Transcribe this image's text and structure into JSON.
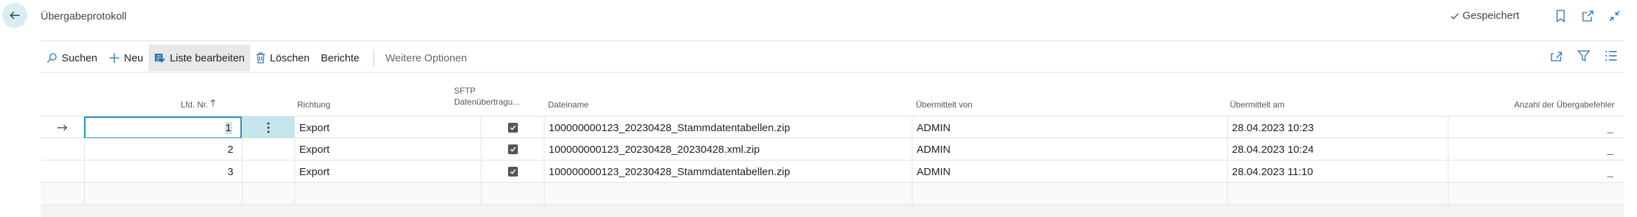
{
  "header": {
    "title": "Übergabeprotokoll",
    "saved_label": "Gespeichert"
  },
  "actions": {
    "search": "Suchen",
    "new": "Neu",
    "edit_list": "Liste bearbeiten",
    "delete": "Löschen",
    "reports": "Berichte",
    "more": "Weitere Optionen"
  },
  "columns": {
    "lfd_nr": "Lfd. Nr.",
    "richtung": "Richtung",
    "sftp_line1": "SFTP",
    "sftp_line2": "Datenübertragu...",
    "dateiname": "Dateiname",
    "uebermittelt_von": "Übermittelt von",
    "uebermittelt_am": "Übermittelt am",
    "anzahl_fehler": "Anzahl der Übergabefehler"
  },
  "rows": [
    {
      "lfd_nr": "1",
      "richtung": "Export",
      "sftp": true,
      "dateiname": "100000000123_20230428_Stammdatentabellen.zip",
      "von": "ADMIN",
      "am": "28.04.2023 10:23",
      "fehler": "_"
    },
    {
      "lfd_nr": "2",
      "richtung": "Export",
      "sftp": true,
      "dateiname": "100000000123_20230428_20230428.xml.zip",
      "von": "ADMIN",
      "am": "28.04.2023 10:24",
      "fehler": "_"
    },
    {
      "lfd_nr": "3",
      "richtung": "Export",
      "sftp": true,
      "dateiname": "100000000123_20230428_Stammdatentabellen.zip",
      "von": "ADMIN",
      "am": "28.04.2023 11:10",
      "fehler": "_"
    }
  ],
  "icons": {
    "back": "back-arrow-icon",
    "saved": "checkmark-icon",
    "bookmark": "bookmark-icon",
    "popout": "open-in-new-window-icon",
    "collapse": "collapse-icon",
    "share": "share-icon",
    "filter": "filter-icon",
    "list": "list-view-icon",
    "search": "search-icon",
    "add": "plus-icon",
    "edit_list": "edit-list-icon",
    "delete": "trash-icon",
    "row_arrow": "row-arrow-icon",
    "row_menu": "more-vertical-icon",
    "sort": "sort-ascending-icon"
  },
  "colors": {
    "accent": "#1d8fb8",
    "back_button_bg": "#d7eef3",
    "row_selected_bg": "#c4e5ec",
    "link": "#1a6fb3"
  }
}
